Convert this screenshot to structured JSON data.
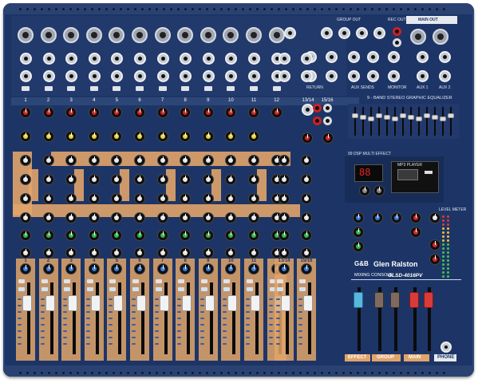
{
  "device": {
    "brand": "Glen Ralston",
    "brand_logo_text": "G&B",
    "product_type": "MIXING CONSOLE",
    "model": "GLSD-4016PV",
    "colors": {
      "chassis": "#1d3566",
      "accent_orange": "#e2a46a",
      "knob_red": "#d7262a",
      "knob_yellow": "#e7d43a",
      "knob_green": "#3bb54a",
      "knob_blue": "#3c7fd9",
      "knob_white": "#e8e8e8"
    }
  },
  "top_section": {
    "main_out_label": "MAIN OUT",
    "group_out_label": "GROUP OUT",
    "rec_out_label": "REC OUT",
    "mono_channel_numbers": [
      "1",
      "2",
      "3",
      "4",
      "5",
      "6",
      "7",
      "8",
      "9",
      "10",
      "11",
      "12"
    ],
    "stereo_channel_numbers": [
      "13/14",
      "15/16"
    ],
    "graphic_eq_label": "9 - BAND STEREO GRAPHIC EQUALIZER",
    "jack_labels": [
      "RETURN",
      "AUX SENDS",
      "MONITOR",
      "AUX 1",
      "AUX 2"
    ]
  },
  "effects": {
    "display_value": "88",
    "display_label": "99 DSP MULTI EFFECT",
    "player_label": "MP3 PLAYER"
  },
  "bottom_section": {
    "fader_channel_numbers": [
      "1",
      "2",
      "3",
      "4",
      "5",
      "6",
      "7",
      "8",
      "9",
      "10",
      "11",
      "12",
      "13/14",
      "15/16"
    ],
    "master_tags": [
      "EFFECT",
      "GROUP",
      "MAIN",
      "PHONE"
    ],
    "meter_label": "LEVEL METER"
  }
}
